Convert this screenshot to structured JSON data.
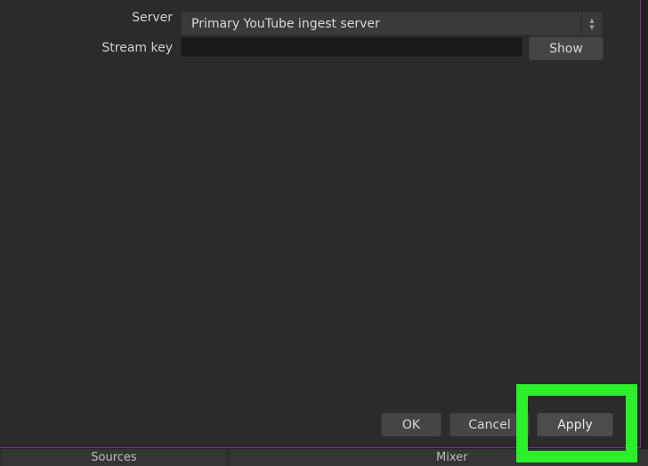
{
  "settings": {
    "server_label": "Server",
    "server_value": "Primary YouTube ingest server",
    "stream_key_label": "Stream key",
    "stream_key_value": "",
    "show_button": "Show"
  },
  "dialog_buttons": {
    "ok": "OK",
    "cancel": "Cancel",
    "apply": "Apply"
  },
  "dock_tabs": {
    "sources": "Sources",
    "mixer": "Mixer"
  },
  "colors": {
    "highlight": "#2bef2b",
    "dialog_border": "#8a2a88"
  }
}
